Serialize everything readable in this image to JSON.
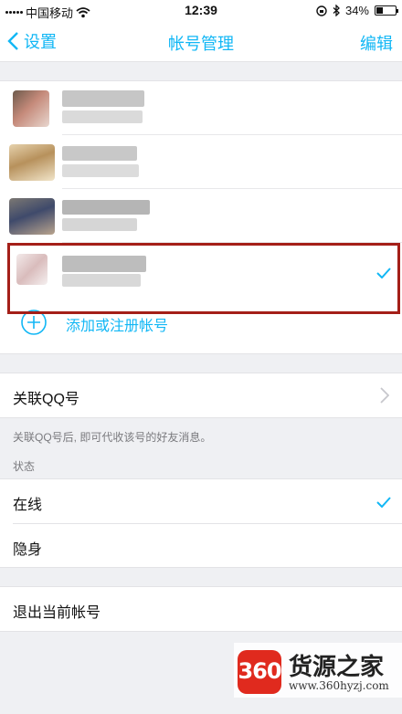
{
  "status_bar": {
    "carrier": "中国移动",
    "time": "12:39",
    "battery": "34%"
  },
  "nav": {
    "back_label": "设置",
    "title": "帐号管理",
    "edit_label": "编辑"
  },
  "accounts": {
    "add_label": "添加或注册帐号"
  },
  "linked_qq": {
    "label": "关联QQ号",
    "hint": "关联QQ号后, 即可代收该号的好友消息。"
  },
  "status": {
    "section_label": "状态",
    "options": [
      {
        "label": "在线",
        "selected": true
      },
      {
        "label": "隐身",
        "selected": false
      }
    ]
  },
  "logout": {
    "label": "退出当前帐号"
  },
  "watermark": {
    "logo_text": "360",
    "name": "货源之家",
    "url": "www.360hyzj.com"
  },
  "colors": {
    "accent": "#12b7f5",
    "highlight": "#a41f18"
  }
}
